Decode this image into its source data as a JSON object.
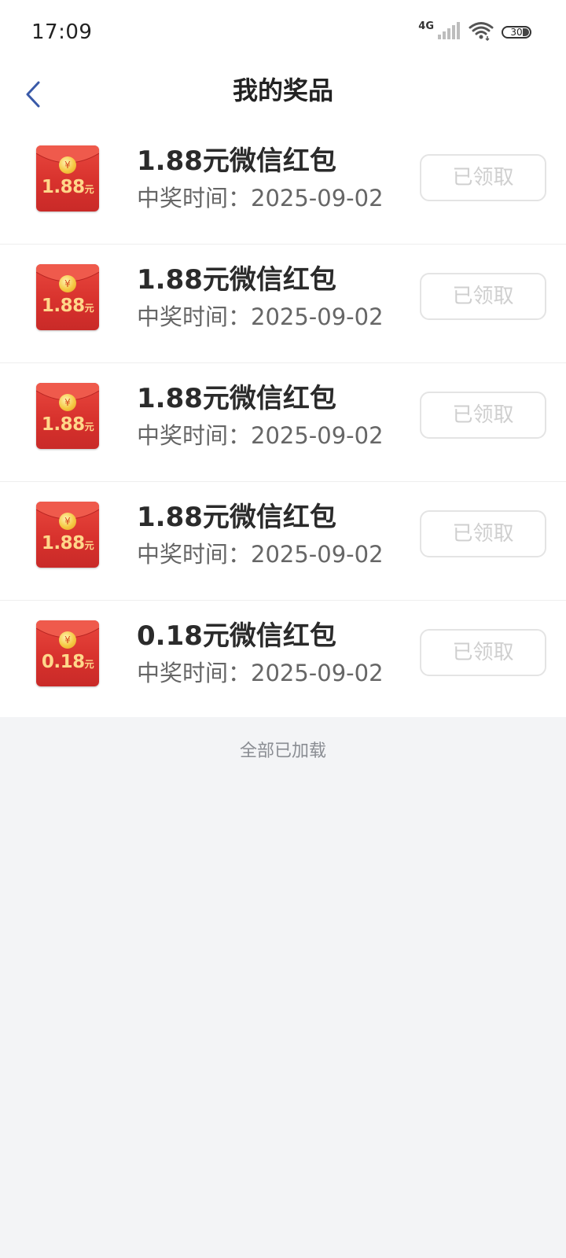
{
  "status_bar": {
    "time": "17:09",
    "network": "4G",
    "battery": "30",
    "icons": [
      "signal-icon",
      "wifi-icon",
      "battery-icon"
    ]
  },
  "header": {
    "title": "我的奖品",
    "back_icon": "chevron-left-icon"
  },
  "prizes": [
    {
      "envelope_amount": "1.88",
      "envelope_unit": "元",
      "title": "1.88元微信红包",
      "time": "中奖时间：2025-09-02",
      "status": "已领取"
    },
    {
      "envelope_amount": "1.88",
      "envelope_unit": "元",
      "title": "1.88元微信红包",
      "time": "中奖时间：2025-09-02",
      "status": "已领取"
    },
    {
      "envelope_amount": "1.88",
      "envelope_unit": "元",
      "title": "1.88元微信红包",
      "time": "中奖时间：2025-09-02",
      "status": "已领取"
    },
    {
      "envelope_amount": "1.88",
      "envelope_unit": "元",
      "title": "1.88元微信红包",
      "time": "中奖时间：2025-09-02",
      "status": "已领取"
    },
    {
      "envelope_amount": "0.18",
      "envelope_unit": "元",
      "title": "0.18元微信红包",
      "time": "中奖时间：2025-09-02",
      "status": "已领取"
    }
  ],
  "envelope_coin_symbol": "¥",
  "footer": {
    "text": "全部已加载"
  },
  "colors": {
    "accent_back": "#3a5aa8",
    "envelope_red": "#d8322d",
    "envelope_gold": "#ffd78a",
    "background": "#f3f4f6"
  }
}
